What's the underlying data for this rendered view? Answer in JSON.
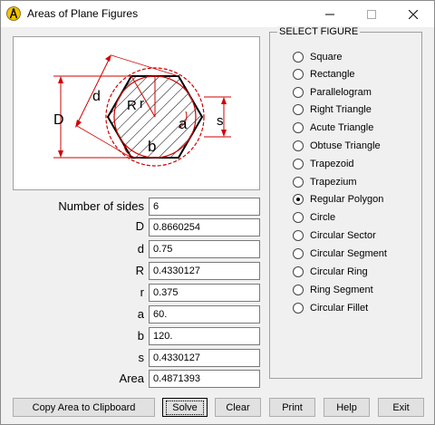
{
  "window": {
    "title": "Areas of Plane Figures",
    "minimize_symbol": "—",
    "maximize_symbol": "☐",
    "close_symbol": "✕"
  },
  "diagram": {
    "labels": {
      "D": "D",
      "d": "d",
      "R": "R",
      "r": "r",
      "a": "a",
      "b": "b",
      "s": "s"
    },
    "line_color": "#d00000"
  },
  "fields": [
    {
      "label": "Number of sides",
      "value": "6"
    },
    {
      "label": "D",
      "value": "0.8660254"
    },
    {
      "label": "d",
      "value": "0.75"
    },
    {
      "label": "R",
      "value": "0.4330127"
    },
    {
      "label": "r",
      "value": "0.375"
    },
    {
      "label": "a",
      "value": "60."
    },
    {
      "label": "b",
      "value": "120."
    },
    {
      "label": "s",
      "value": "0.4330127"
    },
    {
      "label": "Area",
      "value": "0.4871393"
    }
  ],
  "select_figure": {
    "title": "SELECT FIGURE",
    "selected": "Regular Polygon",
    "options": [
      "Square",
      "Rectangle",
      "Parallelogram",
      "Right Triangle",
      "Acute Triangle",
      "Obtuse Triangle",
      "Trapezoid",
      "Trapezium",
      "Regular Polygon",
      "Circle",
      "Circular Sector",
      "Circular Segment",
      "Circular Ring",
      "Ring Segment",
      "Circular Fillet"
    ]
  },
  "buttons": {
    "copy": "Copy Area to Clipboard",
    "solve": "Solve",
    "clear": "Clear",
    "print": "Print",
    "help": "Help",
    "exit": "Exit"
  }
}
